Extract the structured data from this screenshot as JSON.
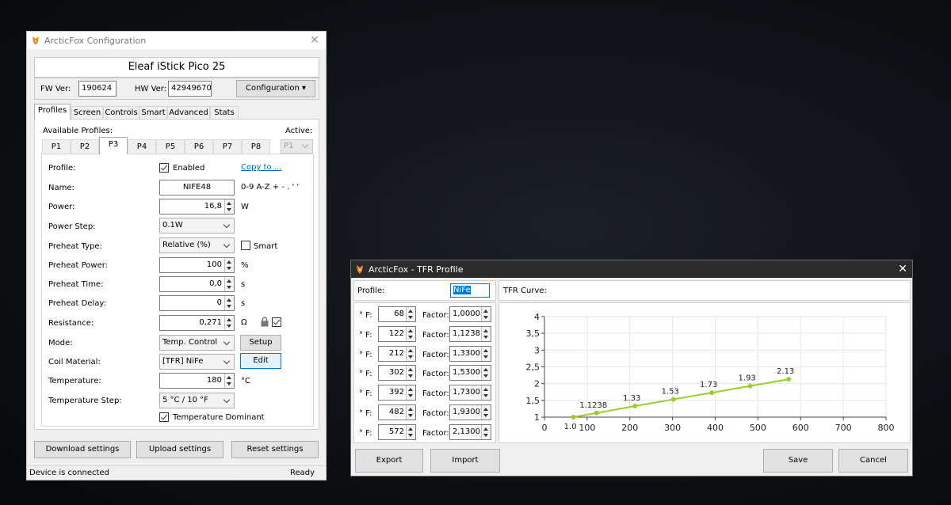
{
  "config": {
    "title": "ArcticFox Configuration",
    "device": "Eleaf iStick Pico 25",
    "fw_label": "FW Ver:",
    "fw_value": "190624",
    "hw_label": "HW Ver:",
    "hw_value": "42949670.(",
    "configuration_button": "Configuration ▾",
    "tabs": [
      "Profiles",
      "Screen",
      "Controls",
      "Smart",
      "Advanced",
      "Stats"
    ],
    "available_profiles_label": "Available Profiles:",
    "active_label": "Active:",
    "active_value": "P1",
    "profile_tabs": [
      "P1",
      "P2",
      "P3",
      "P4",
      "P5",
      "P6",
      "P7",
      "P8"
    ],
    "selected_profile": "P3",
    "profile_label": "Profile:",
    "enabled_label": "Enabled",
    "copy_to": "Copy to ...",
    "name_label": "Name:",
    "name_value": "NIFE48",
    "name_hint": "0-9 A-Z + - . ' '",
    "power_label": "Power:",
    "power_value": "16,8",
    "power_unit": "W",
    "power_step_label": "Power Step:",
    "power_step_value": "0.1W",
    "preheat_type_label": "Preheat Type:",
    "preheat_type_value": "Relative (%)",
    "smart_label": "Smart",
    "preheat_power_label": "Preheat Power:",
    "preheat_power_value": "100",
    "preheat_power_unit": "%",
    "preheat_time_label": "Preheat Time:",
    "preheat_time_value": "0,0",
    "preheat_time_unit": "s",
    "preheat_delay_label": "Preheat Delay:",
    "preheat_delay_value": "0",
    "preheat_delay_unit": "s",
    "resistance_label": "Resistance:",
    "resistance_value": "0,271",
    "resistance_unit": "Ω",
    "mode_label": "Mode:",
    "mode_value": "Temp. Control",
    "setup_button": "Setup",
    "coil_label": "Coil Material:",
    "coil_value": "[TFR] NiFe",
    "edit_button": "Edit",
    "temperature_label": "Temperature:",
    "temperature_value": "180",
    "temperature_unit": "°C",
    "temp_step_label": "Temperature Step:",
    "temp_step_value": "5 °C / 10 °F",
    "temp_dominant_label": "Temperature Dominant",
    "download_button": "Download settings",
    "upload_button": "Upload settings",
    "reset_button": "Reset settings",
    "status_left": "Device is connected",
    "status_right": "Ready"
  },
  "tfr": {
    "title": "ArcticFox - TFR Profile",
    "profile_label": "Profile:",
    "profile_value": "NiFe",
    "curve_label": "TFR Curve:",
    "rows": [
      {
        "f_label": "° F:",
        "f": "68",
        "factor_label": "Factor:",
        "factor": "1,0000"
      },
      {
        "f_label": "° F:",
        "f": "122",
        "factor_label": "Factor:",
        "factor": "1,1238"
      },
      {
        "f_label": "° F:",
        "f": "212",
        "factor_label": "Factor:",
        "factor": "1,3300"
      },
      {
        "f_label": "° F:",
        "f": "302",
        "factor_label": "Factor:",
        "factor": "1,5300"
      },
      {
        "f_label": "° F:",
        "f": "392",
        "factor_label": "Factor:",
        "factor": "1,7300"
      },
      {
        "f_label": "° F:",
        "f": "482",
        "factor_label": "Factor:",
        "factor": "1,9300"
      },
      {
        "f_label": "° F:",
        "f": "572",
        "factor_label": "Factor:",
        "factor": "2,1300"
      }
    ],
    "export_button": "Export",
    "import_button": "Import",
    "save_button": "Save",
    "cancel_button": "Cancel"
  },
  "chart_data": {
    "type": "line",
    "x": [
      68,
      122,
      212,
      302,
      392,
      482,
      572
    ],
    "values": [
      1.0,
      1.1238,
      1.33,
      1.53,
      1.73,
      1.93,
      2.13
    ],
    "point_labels": [
      "1.0",
      "1.1238",
      "1.33",
      "1.53",
      "1.73",
      "1.93",
      "2.13"
    ],
    "xlim": [
      0,
      800
    ],
    "ylim": [
      1,
      4
    ],
    "x_ticks": [
      "0",
      "100",
      "200",
      "300",
      "400",
      "500",
      "600",
      "700",
      "800"
    ],
    "y_ticks": [
      "1",
      "1,5",
      "2",
      "2,5",
      "3",
      "3,5",
      "4"
    ],
    "grid": true,
    "line_color": "#9acd32"
  }
}
